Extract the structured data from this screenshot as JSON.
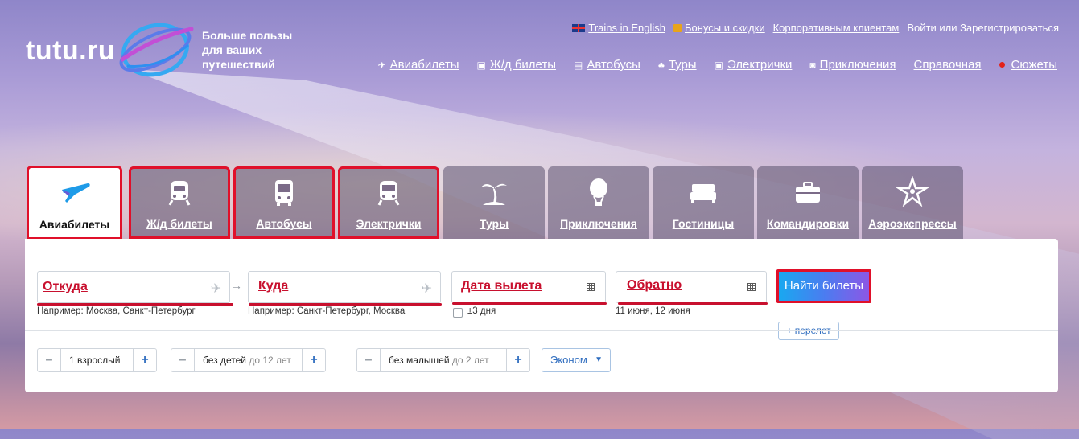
{
  "brand": {
    "logo_text": "tutu.ru",
    "tagline": "Больше пользы для ваших путешествий"
  },
  "top_links": [
    {
      "label": "Trains in English",
      "icon": "uk-flag-icon"
    },
    {
      "label": "Бонусы и скидки",
      "icon": "gift-icon"
    },
    {
      "label": "Корпоративным клиентам"
    },
    {
      "label": "Войти или Зарегистрироваться"
    }
  ],
  "main_nav": [
    {
      "label": "Авиабилеты",
      "icon": "plane-icon"
    },
    {
      "label": "Ж/д билеты",
      "icon": "train-icon"
    },
    {
      "label": "Автобусы",
      "icon": "bus-icon"
    },
    {
      "label": "Туры",
      "icon": "palm-icon"
    },
    {
      "label": "Электрички",
      "icon": "suburban-train-icon"
    },
    {
      "label": "Приключения",
      "icon": "camera-icon"
    },
    {
      "label": "Справочная"
    },
    {
      "label": "Сюжеты",
      "icon": "red-dot-icon"
    }
  ],
  "tabs": [
    {
      "label": "Авиабилеты",
      "icon": "plane-icon",
      "active": true
    },
    {
      "label": "Ж/д билеты",
      "icon": "train-icon"
    },
    {
      "label": "Автобусы",
      "icon": "bus-icon"
    },
    {
      "label": "Электрички",
      "icon": "suburban-train-icon"
    },
    {
      "label": "Туры",
      "icon": "palm-icon"
    },
    {
      "label": "Приключения",
      "icon": "balloon-icon"
    },
    {
      "label": "Гостиницы",
      "icon": "bed-icon"
    },
    {
      "label": "Командировки",
      "icon": "briefcase-icon"
    },
    {
      "label": "Аэроэкспрессы",
      "icon": "aeroexpress-icon"
    }
  ],
  "search": {
    "from_label": "Откуда",
    "from_hint": "Например: Москва, Санкт-Петербург",
    "to_label": "Куда",
    "to_hint": "Например: Санкт-Петербург, Москва",
    "depart_label": "Дата вылета",
    "flex_label": "±3 дня",
    "return_label": "Обратно",
    "return_hint": "11 июня, 12 июня",
    "submit_label": "Найти билеты",
    "add_flight_label": "+ перелет",
    "arrow": "→"
  },
  "passengers": {
    "adults": "1 взрослый",
    "children_main": "без детей",
    "children_sub": "до 12 лет",
    "infants_main": "без малышей",
    "infants_sub": "до 2 лет",
    "minus": "–",
    "plus": "+"
  },
  "cabin_class": {
    "value": "Эконом",
    "caret": "▼"
  },
  "colors": {
    "accent_red": "#c8102e",
    "highlight": "#e0102a",
    "link_blue": "#2f6dbf"
  }
}
